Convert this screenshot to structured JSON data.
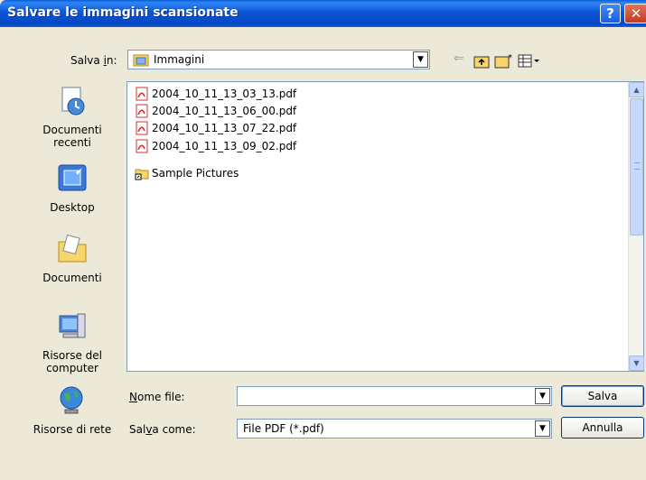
{
  "window": {
    "title": "Salvare le immagini scansionate",
    "help_label": "?",
    "close_label": "✕"
  },
  "savein": {
    "label": "Salva in:",
    "value": "Immagini"
  },
  "places": [
    {
      "label": "Documenti recenti",
      "icon": "recent-documents-icon"
    },
    {
      "label": "Desktop",
      "icon": "desktop-icon"
    },
    {
      "label": "Documenti",
      "icon": "documents-folder-icon"
    },
    {
      "label": "Risorse del computer",
      "icon": "my-computer-icon"
    },
    {
      "label": "Risorse di rete",
      "icon": "network-icon"
    }
  ],
  "files": [
    {
      "name": "2004_10_11_13_03_13.pdf",
      "icon": "pdf-icon"
    },
    {
      "name": "2004_10_11_13_06_00.pdf",
      "icon": "pdf-icon"
    },
    {
      "name": "2004_10_11_13_07_22.pdf",
      "icon": "pdf-icon"
    },
    {
      "name": "2004_10_11_13_09_02.pdf",
      "icon": "pdf-icon"
    },
    {
      "name": "Sample Pictures",
      "icon": "folder-shortcut-icon"
    }
  ],
  "filename": {
    "label": "Nome file:",
    "value": ""
  },
  "savetype": {
    "label": "Salva come:",
    "value": "File PDF (*.pdf)"
  },
  "buttons": {
    "save": "Salva",
    "cancel": "Annulla"
  },
  "colors": {
    "titlebar": "#0b56d6",
    "dialog_bg": "#ece9d8",
    "border": "#7f9db9"
  }
}
